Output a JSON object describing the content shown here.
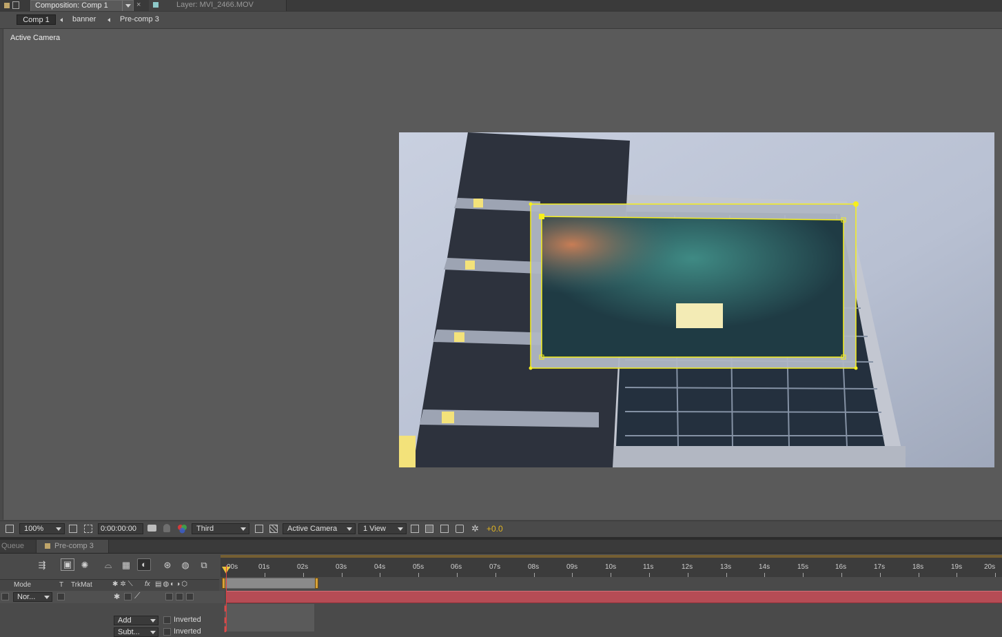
{
  "tabs": {
    "composition": "Composition: Comp 1",
    "layer": "Layer: MVI_2466.MOV"
  },
  "breadcrumbs": [
    "Comp 1",
    "banner",
    "Pre-comp 3"
  ],
  "viewer": {
    "camera_label": "Active Camera"
  },
  "viewer_toolbar": {
    "zoom": "100%",
    "timecode": "0:00:00:00",
    "resolution": "Third",
    "camera": "Active Camera",
    "view_layout": "1 View",
    "exposure": "+0.0",
    "exposure_color": "#e0b422"
  },
  "timeline": {
    "tabs": [
      "Queue",
      "Pre-comp 3"
    ],
    "columns": {
      "mode": "Mode",
      "t": "T",
      "trkmat": "TrkMat"
    },
    "layer_mode": "Nor...",
    "mask_rows": [
      {
        "mode": "Add",
        "inverted_label": "Inverted"
      },
      {
        "mode": "Subt...",
        "inverted_label": "Inverted"
      }
    ],
    "ruler_ticks": [
      "00s",
      "01s",
      "02s",
      "03s",
      "04s",
      "05s",
      "06s",
      "07s",
      "08s",
      "09s",
      "10s",
      "11s",
      "12s",
      "13s",
      "14s",
      "15s",
      "16s",
      "17s",
      "18s",
      "19s",
      "20s"
    ],
    "layer_bar_color": "#b64c55",
    "mask_color": "#f7ef1c"
  }
}
